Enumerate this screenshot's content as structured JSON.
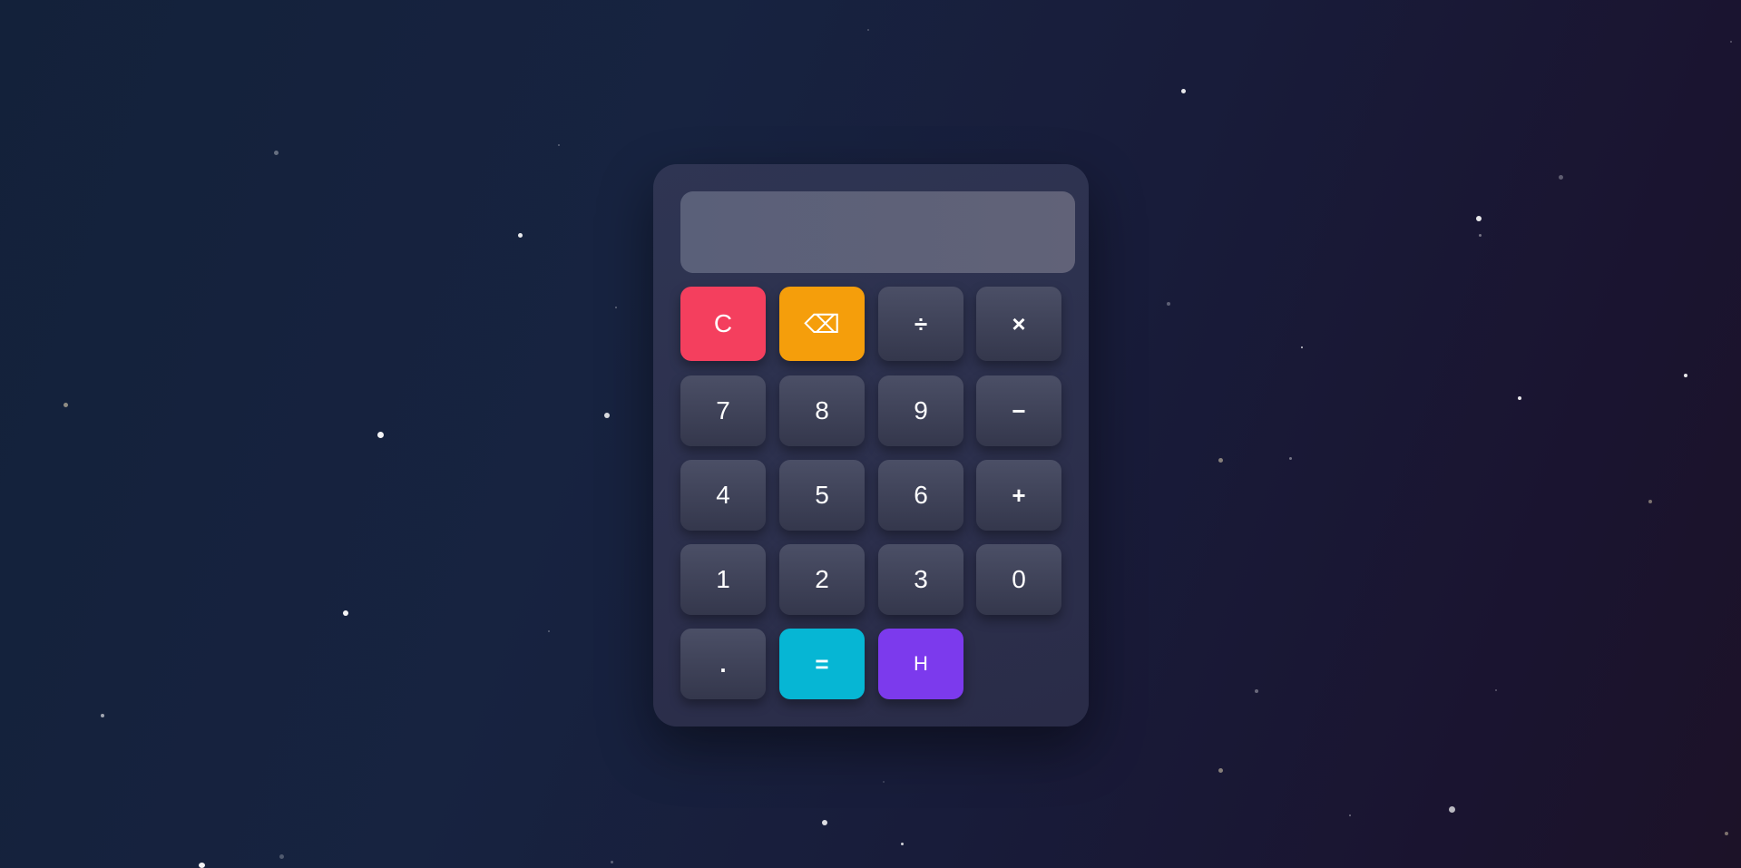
{
  "display": {
    "value": ""
  },
  "keys": {
    "clear": "C",
    "backspace": "⌫",
    "divide": "÷",
    "multiply": "×",
    "seven": "7",
    "eight": "8",
    "nine": "9",
    "minus": "−",
    "four": "4",
    "five": "5",
    "six": "6",
    "plus": "+",
    "one": "1",
    "two": "2",
    "three": "3",
    "zero": "0",
    "decimal": ".",
    "equals": "=",
    "history": "H"
  },
  "colors": {
    "clear": "#f43f5e",
    "backspace": "#f59e0b",
    "equals": "#06b6d4",
    "history": "#7c3aed",
    "key": "#3f4359",
    "panel": "#2c304c",
    "display": "#5d6178"
  }
}
